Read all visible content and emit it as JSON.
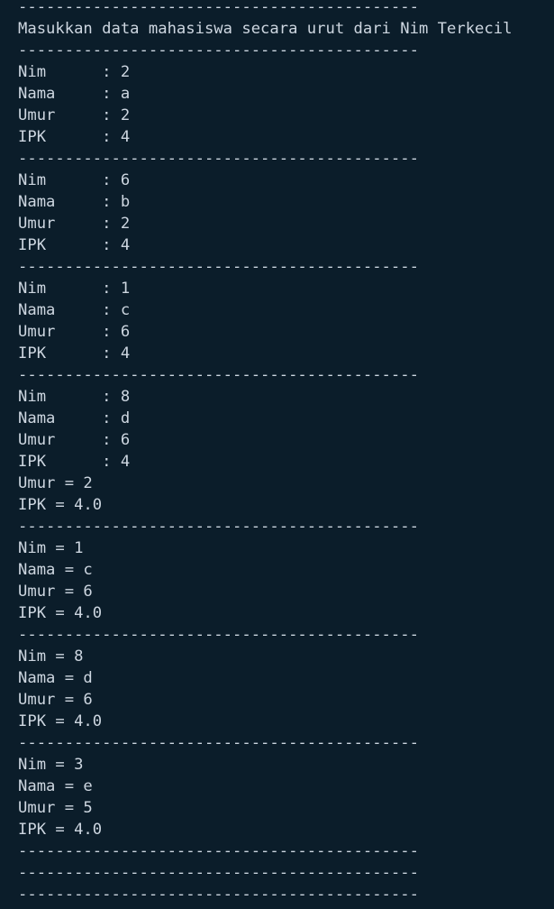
{
  "terminal": {
    "lines": [
      "-------------------------------------------",
      "Masukkan data mahasiswa secara urut dari Nim Terkecil",
      "-------------------------------------------",
      "Nim      : 2",
      "Nama     : a",
      "Umur     : 2",
      "IPK      : 4",
      "-------------------------------------------",
      "Nim      : 6",
      "Nama     : b",
      "Umur     : 2",
      "IPK      : 4",
      "-------------------------------------------",
      "Nim      : 1",
      "Nama     : c",
      "Umur     : 6",
      "IPK      : 4",
      "-------------------------------------------",
      "Nim      : 8",
      "Nama     : d",
      "Umur     : 6",
      "IPK      : 4",
      "Umur = 2",
      "IPK = 4.0",
      "-------------------------------------------",
      "Nim = 1",
      "Nama = c",
      "Umur = 6",
      "IPK = 4.0",
      "-------------------------------------------",
      "Nim = 8",
      "Nama = d",
      "Umur = 6",
      "IPK = 4.0",
      "-------------------------------------------",
      "Nim = 3",
      "Nama = e",
      "Umur = 5",
      "IPK = 4.0",
      "-------------------------------------------",
      "-------------------------------------------",
      "-------------------------------------------"
    ]
  },
  "colors": {
    "background": "#0b1d2a",
    "text": "#cdd6e0"
  }
}
